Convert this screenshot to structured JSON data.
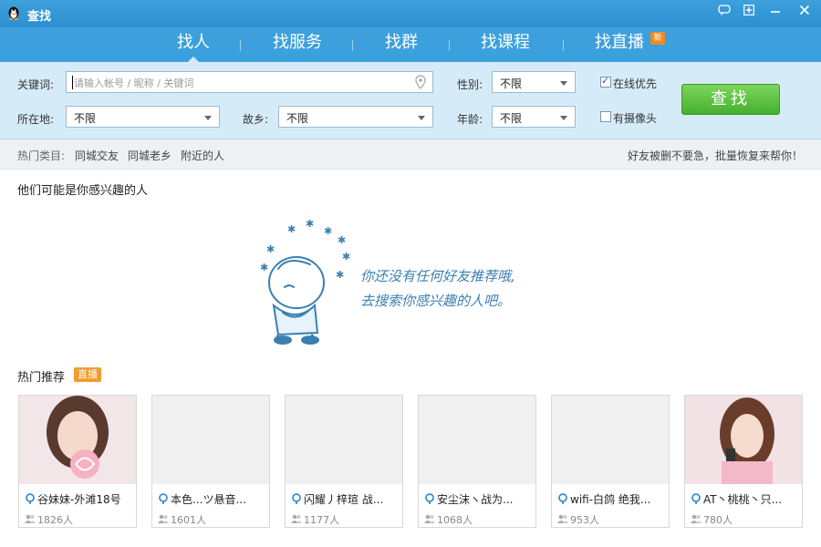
{
  "window": {
    "title": "查找"
  },
  "tabs": [
    {
      "label": "找人",
      "active": true
    },
    {
      "label": "找服务"
    },
    {
      "label": "找群"
    },
    {
      "label": "找课程"
    },
    {
      "label": "找直播",
      "badge": "新"
    }
  ],
  "search": {
    "keyword_label": "关键词:",
    "keyword_placeholder": "请输入帐号 / 昵称 / 关键词",
    "location_label": "所在地:",
    "location_value": "不限",
    "hometown_label": "故乡:",
    "hometown_value": "不限",
    "gender_label": "性别:",
    "gender_value": "不限",
    "age_label": "年龄:",
    "age_value": "不限",
    "online_first_label": "在线优先",
    "online_first_checked": true,
    "has_camera_label": "有摄像头",
    "has_camera_checked": false,
    "search_button": "查找"
  },
  "hot": {
    "label": "热门类目:",
    "items": [
      "同城交友",
      "同城老乡",
      "附近的人"
    ],
    "recover_link": "好友被删不要急，批量恢复来帮你！"
  },
  "recommend": {
    "title": "他们可能是你感兴趣的人",
    "empty_line1": "你还没有任何好友推荐哦,",
    "empty_line2": "去搜索你感兴趣的人吧。"
  },
  "hot_recommend": {
    "title": "热门推荐",
    "badge": "直播",
    "cards": [
      {
        "name": "谷妹妹-外滩18号",
        "count": "1826人"
      },
      {
        "name": "本色...ツ悬音...",
        "count": "1601人"
      },
      {
        "name": "闪耀丿梓瑄 战...",
        "count": "1177人"
      },
      {
        "name": "安尘沫ヽ战为...",
        "count": "1068人"
      },
      {
        "name": "wifi-白鸽 绝我...",
        "count": "953人"
      },
      {
        "name": "AT丶桃桃丶只...",
        "count": "780人"
      }
    ]
  },
  "colors": {
    "titlebar": "#2b8fd1",
    "search_panel": "#d6ebf8",
    "search_button": "#45b030",
    "badge_orange": "#f29c2c"
  }
}
